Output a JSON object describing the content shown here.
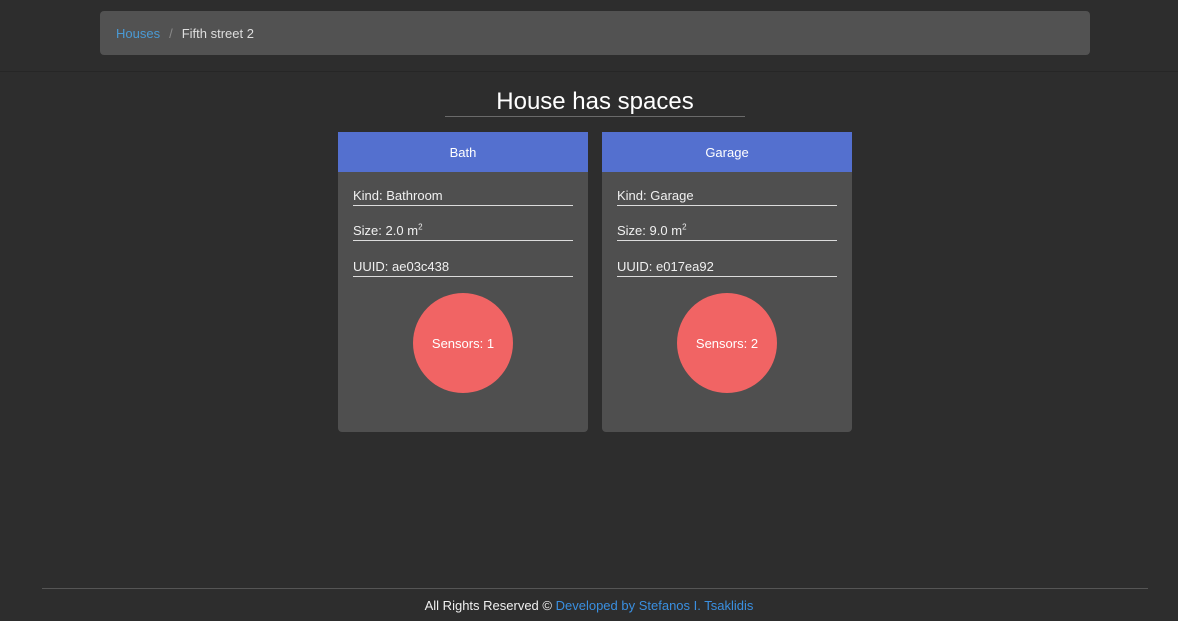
{
  "breadcrumb": {
    "link_label": "Houses",
    "separator": "/",
    "current": "Fifth street 2"
  },
  "page_title": "House has spaces",
  "spaces": [
    {
      "name": "Bath",
      "kind_label": "Kind:",
      "kind": "Bathroom",
      "size_label": "Size:",
      "size": "2.0",
      "size_unit": "m",
      "size_exp": "2",
      "uuid_label": "UUID:",
      "uuid": "ae03c438",
      "sensors_label": "Sensors:",
      "sensors": "1"
    },
    {
      "name": "Garage",
      "kind_label": "Kind:",
      "kind": "Garage",
      "size_label": "Size:",
      "size": "9.0",
      "size_unit": "m",
      "size_exp": "2",
      "uuid_label": "UUID:",
      "uuid": "e017ea92",
      "sensors_label": "Sensors:",
      "sensors": "2"
    }
  ],
  "footer": {
    "text": "All Rights Reserved ©",
    "link_text": "Developed by Stefanos I. Tsaklidis"
  },
  "colors": {
    "background": "#2d2d2d",
    "panel": "#4f4f4f",
    "card_header": "#5470cf",
    "sensor_button": "#f16464",
    "link": "#4a9ad4"
  }
}
